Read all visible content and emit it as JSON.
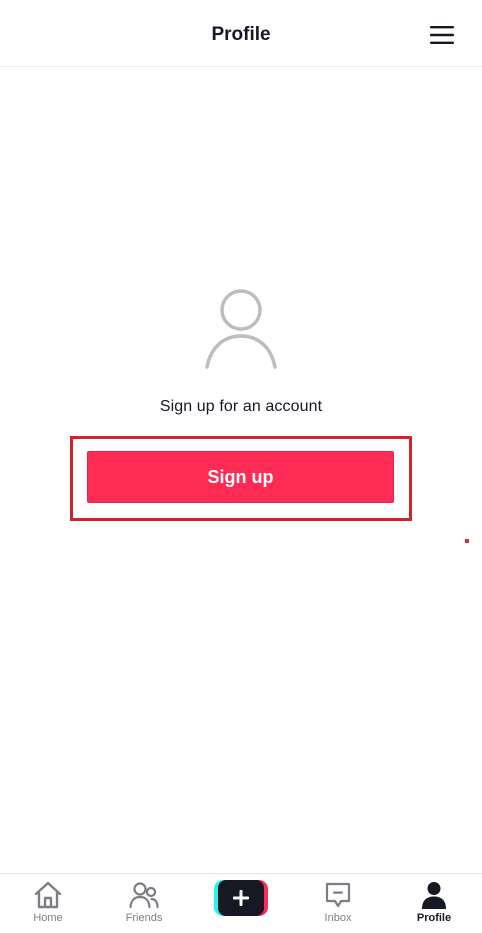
{
  "header": {
    "title": "Profile",
    "menu_icon": "hamburger-menu-icon"
  },
  "empty_state": {
    "avatar_icon": "person-outline-icon",
    "prompt": "Sign up for an account",
    "signup_label": "Sign up"
  },
  "colors": {
    "accent": "#fe2c55",
    "cyan": "#25f4ee",
    "text_primary": "#161823",
    "text_secondary": "#7d7e85",
    "highlight_frame": "#d2232d"
  },
  "bottom_nav": {
    "items": [
      {
        "label": "Home",
        "icon": "home-icon",
        "active": false
      },
      {
        "label": "Friends",
        "icon": "friends-icon",
        "active": false
      },
      {
        "label": "",
        "icon": "plus-icon",
        "active": false
      },
      {
        "label": "Inbox",
        "icon": "inbox-icon",
        "active": false
      },
      {
        "label": "Profile",
        "icon": "profile-icon",
        "active": true
      }
    ]
  }
}
